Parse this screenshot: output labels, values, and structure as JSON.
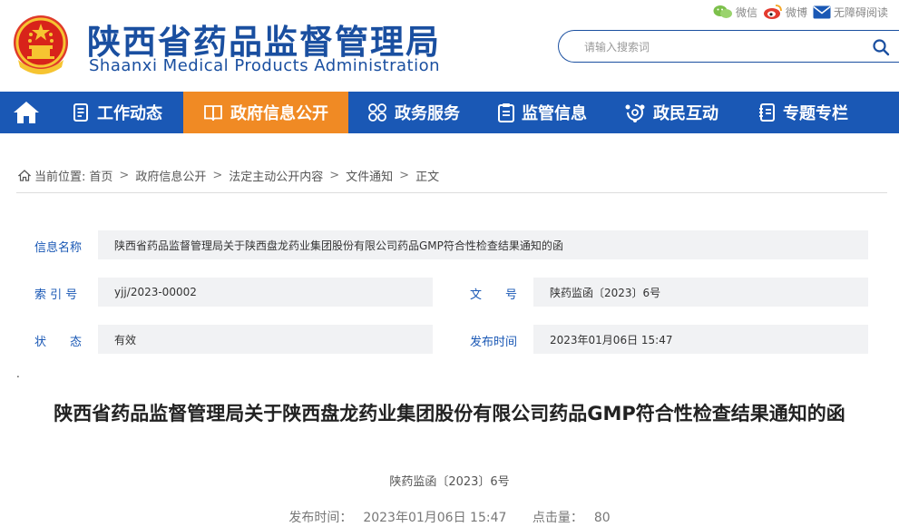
{
  "header": {
    "title_cn": "陕西省药品监督管理局",
    "title_en": "Shaanxi Medical Products Administration",
    "top_links": [
      {
        "label": "微信",
        "icon": "wechat-icon"
      },
      {
        "label": "微博",
        "icon": "weibo-icon"
      },
      {
        "label": "无障碍阅读",
        "icon": "mail-icon"
      }
    ],
    "search": {
      "placeholder": "请输入搜索词",
      "value": ""
    }
  },
  "nav": {
    "items": [
      {
        "label": "工作动态",
        "icon": "document-list-icon"
      },
      {
        "label": "政府信息公开",
        "icon": "book-icon",
        "active": true
      },
      {
        "label": "政务服务",
        "icon": "grid-flower-icon"
      },
      {
        "label": "监管信息",
        "icon": "clipboard-icon"
      },
      {
        "label": "政民互动",
        "icon": "interaction-icon"
      },
      {
        "label": "专题专栏",
        "icon": "notebook-icon"
      }
    ]
  },
  "breadcrumb": {
    "prefix": "当前位置:",
    "items": [
      "首页",
      "政府信息公开",
      "法定主动公开内容",
      "文件通知",
      "正文"
    ]
  },
  "info": {
    "name_label": "信息名称",
    "name_value": "陕西省药品监督管理局关于陕西盘龙药业集团股份有限公司药品GMP符合性检查结果通知的函",
    "index_label": "索 引 号",
    "index_value": "yjj/2023-00002",
    "docno_label": "文　　号",
    "docno_value": "陕药监函〔2023〕6号",
    "status_label": "状　　态",
    "status_value": "有效",
    "date_label": "发布时间",
    "date_value": "2023年01月06日 15:47"
  },
  "article": {
    "dot": ".",
    "title": "陕西省药品监督管理局关于陕西盘龙药业集团股份有限公司药品GMP符合性检查结果通知的函",
    "doc_number": "陕药监函〔2023〕6号",
    "publish_label": "发布时间：",
    "publish_time": "2023年01月06日 15:47",
    "hits_label": "点击量：",
    "hits": "80"
  },
  "colors": {
    "brand_blue": "#1a58b5",
    "title_blue": "#1a4fa0",
    "active_orange": "#f08a24",
    "info_bg": "#f1f2f4"
  }
}
